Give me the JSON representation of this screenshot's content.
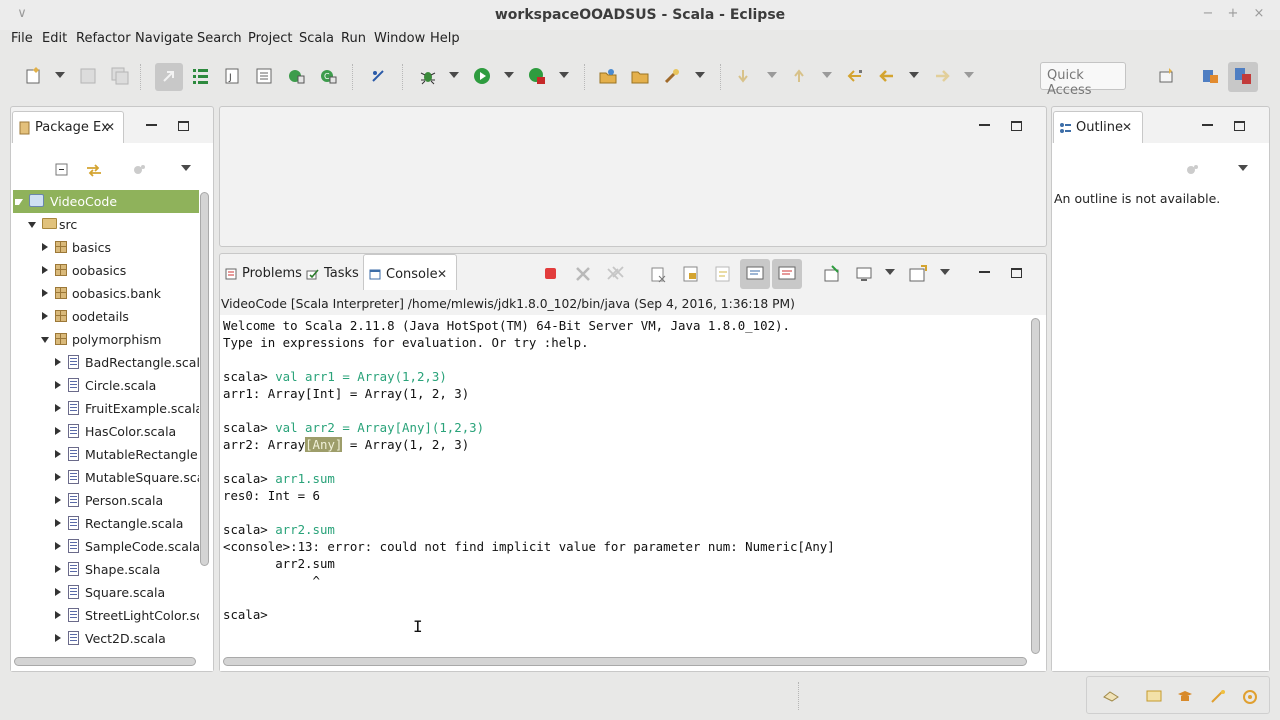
{
  "window": {
    "title": "workspaceOOADSUS - Scala - Eclipse",
    "controls": [
      "∨",
      "−",
      "+",
      "×"
    ]
  },
  "menu": [
    "File",
    "Edit",
    "Refactor",
    "Navigate",
    "Search",
    "Project",
    "Scala",
    "Run",
    "Window",
    "Help"
  ],
  "toolbar": {
    "quick_access_placeholder": "Quick Access"
  },
  "package_explorer": {
    "tab_label": "Package Ex",
    "tree": [
      {
        "label": "VideoCode",
        "type": "project",
        "expanded": true,
        "selected": true
      },
      {
        "label": "src",
        "type": "folder",
        "expanded": true
      },
      {
        "label": "basics",
        "type": "package",
        "expanded": false
      },
      {
        "label": "oobasics",
        "type": "package",
        "expanded": false
      },
      {
        "label": "oobasics.bank",
        "type": "package",
        "expanded": false
      },
      {
        "label": "oodetails",
        "type": "package",
        "expanded": false
      },
      {
        "label": "polymorphism",
        "type": "package",
        "expanded": true
      },
      {
        "label": "BadRectangle.scala",
        "type": "file"
      },
      {
        "label": "Circle.scala",
        "type": "file"
      },
      {
        "label": "FruitExample.scala",
        "type": "file"
      },
      {
        "label": "HasColor.scala",
        "type": "file"
      },
      {
        "label": "MutableRectangle.s",
        "type": "file"
      },
      {
        "label": "MutableSquare.scal",
        "type": "file"
      },
      {
        "label": "Person.scala",
        "type": "file"
      },
      {
        "label": "Rectangle.scala",
        "type": "file"
      },
      {
        "label": "SampleCode.scala",
        "type": "file"
      },
      {
        "label": "Shape.scala",
        "type": "file"
      },
      {
        "label": "Square.scala",
        "type": "file"
      },
      {
        "label": "StreetLightColor.sca",
        "type": "file"
      },
      {
        "label": "Vect2D.scala",
        "type": "file"
      }
    ]
  },
  "outline": {
    "tab_label": "Outline",
    "message": "An outline is not available."
  },
  "bottom_panel": {
    "tabs": [
      "Problems",
      "Tasks",
      "Console"
    ],
    "active_tab": "Console",
    "console_header": "VideoCode [Scala Interpreter] /home/mlewis/jdk1.8.0_102/bin/java (Sep 4, 2016, 1:36:18 PM)",
    "lines": [
      "Welcome to Scala 2.11.8 (Java HotSpot(TM) 64-Bit Server VM, Java 1.8.0_102).",
      "Type in expressions for evaluation. Or try :help.",
      "",
      "scala> |val arr1 = Array(1,2,3)",
      "arr1: Array[Int] = Array(1, 2, 3)",
      "",
      "scala> |val arr2 = Array[Any](1,2,3)",
      "arr2: Array|[Any]| = Array(1, 2, 3)",
      "",
      "scala> |arr1.sum",
      "res0: Int = 6",
      "",
      "scala> |arr2.sum",
      "<console>:13: error: could not find implicit value for parameter num: Numeric[Any]",
      "       arr2.sum",
      "            ^",
      "",
      "scala> "
    ]
  },
  "colors": {
    "selection": "#8fb25b",
    "input_text": "#2aa37a",
    "highlight": "#9d9d6a"
  }
}
